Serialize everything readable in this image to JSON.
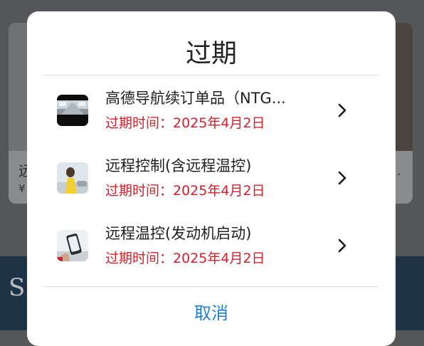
{
  "background": {
    "left_card_title": "远",
    "left_card_price": "¥",
    "right_card_title": "..",
    "banner_text": "S"
  },
  "dialog": {
    "title": "过期",
    "items": [
      {
        "name": "高德导航续订单品（NTG...",
        "expiry": "过期时间：2025年4月2日",
        "thumb_icon": "navigation-product-thumbnail"
      },
      {
        "name": "远程控制(含远程温控)",
        "expiry": "过期时间：2025年4月2日",
        "thumb_icon": "remote-control-product-thumbnail"
      },
      {
        "name": "远程温控(发动机启动)",
        "expiry": "过期时间：2025年4月2日",
        "thumb_icon": "remote-climate-product-thumbnail"
      }
    ],
    "cancel_label": "取消"
  },
  "colors": {
    "expiry_text": "#d4202a",
    "cancel_text": "#1f7fd0",
    "overlay": "#555657"
  }
}
